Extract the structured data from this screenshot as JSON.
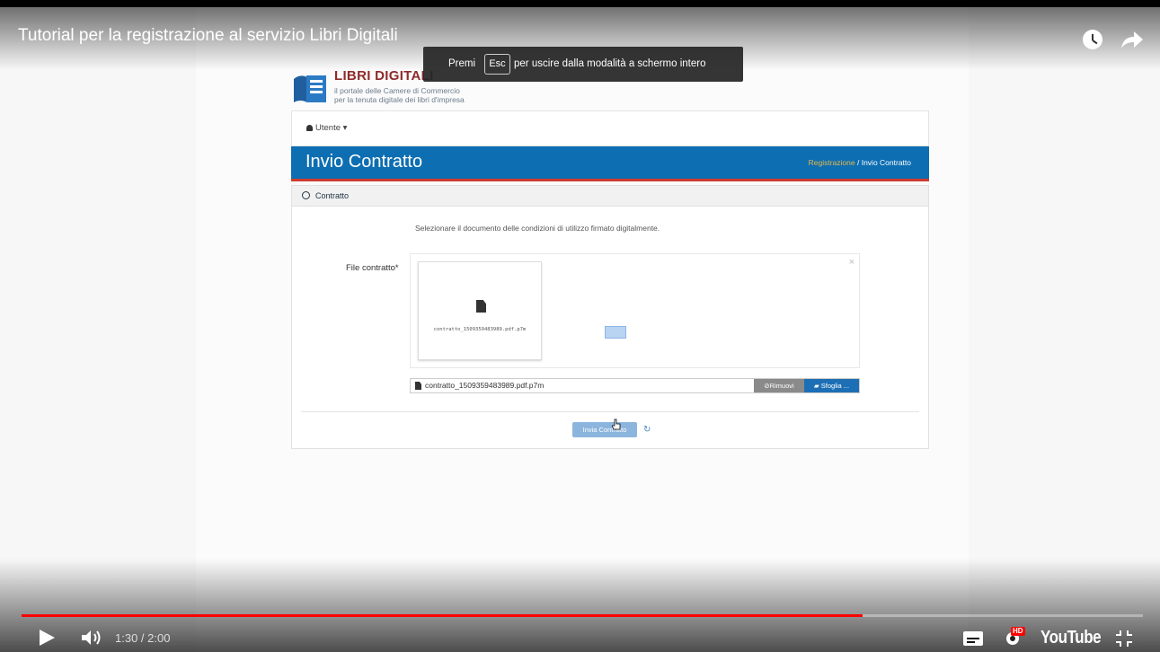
{
  "video": {
    "title": "Tutorial per la registrazione al servizio Libri Digitali",
    "esc_toast": {
      "before": "Premi",
      "key": "Esc",
      "after": "per uscire dalla modalità a schermo intero"
    },
    "time": "1:30 / 2:00",
    "progress_fraction": 0.75,
    "hd_badge": "HD",
    "youtube_logo": "YouTube",
    "icons": [
      "clock-icon",
      "share-icon",
      "play-icon",
      "volume-icon",
      "captions-icon",
      "settings-icon",
      "exit-fullscreen-icon"
    ],
    "colors": {
      "progress_played": "#ff0000"
    }
  },
  "site": {
    "logo": {
      "title": "LIBRI DIGITALI",
      "line1": "il portale delle Camere di Commercio",
      "line2": "per la tenuta digitale dei libri d'impresa"
    },
    "user_menu": "Utente",
    "page_title": "Invio Contratto",
    "breadcrumb": {
      "link": "Registrazione",
      "separator": "/",
      "current": "Invio Contratto"
    },
    "panel": {
      "title": "Contratto",
      "instruction": "Selezionare il documento delle condizioni di utilizzo firmato digitalmente.",
      "file_label": "File contratto*",
      "close_symbol": "×",
      "preview_filename": "contratto_1509359483989.pdf.p7m",
      "file_value": "contratto_1509359483989.pdf.p7m",
      "remove_button": "Rimuovi",
      "browse_button": "Sfoglia ...",
      "submit_button": "Invia Contratto",
      "reset_symbol": "↻"
    },
    "colors": {
      "header_blue": "#0d6eb2",
      "header_accent": "#cf3c2e",
      "breadcrumb_link": "#e6b84a"
    }
  }
}
